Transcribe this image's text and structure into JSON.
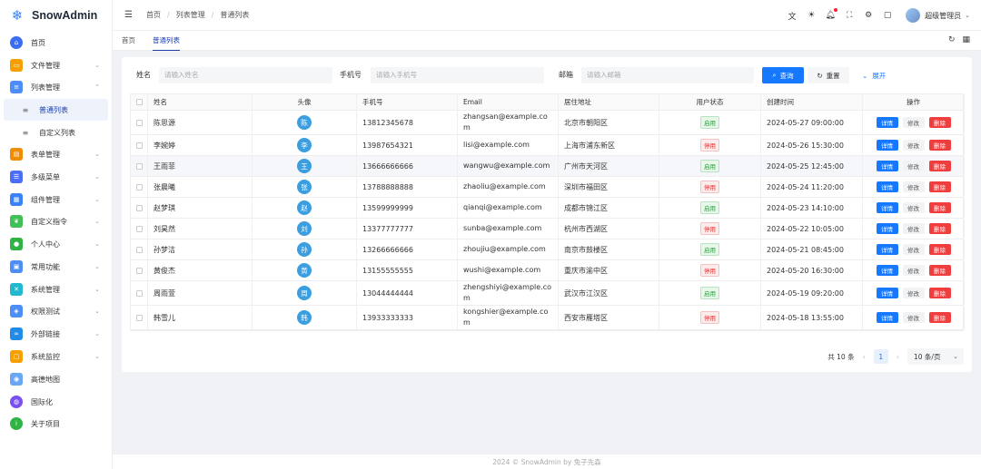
{
  "app": {
    "name": "SnowAdmin",
    "logo_icon": "snowflake-icon"
  },
  "sidebar": {
    "items": [
      {
        "label": "首页",
        "icon": "home-icon",
        "color": "#3b6df0",
        "expandable": false
      },
      {
        "label": "文件管理",
        "icon": "folder-icon",
        "color": "#f59f00",
        "expandable": true
      },
      {
        "label": "列表管理",
        "icon": "list-icon",
        "color": "#4c8df6",
        "expandable": true,
        "expanded": true
      },
      {
        "label": "普通列表",
        "sub": true,
        "active": true
      },
      {
        "label": "自定义列表",
        "sub": true
      },
      {
        "label": "表单管理",
        "icon": "form-icon",
        "color": "#f08c00",
        "expandable": true
      },
      {
        "label": "多级菜单",
        "icon": "menu-icon",
        "color": "#4c6ef5",
        "expandable": true
      },
      {
        "label": "组件管理",
        "icon": "grid-icon",
        "color": "#3b82f6",
        "expandable": true
      },
      {
        "label": "自定义指令",
        "icon": "leaf-icon",
        "color": "#40c057",
        "expandable": true
      },
      {
        "label": "个人中心",
        "icon": "user-icon",
        "color": "#2fb344",
        "expandable": true
      },
      {
        "label": "常用功能",
        "icon": "function-icon",
        "color": "#4c8df6",
        "expandable": true
      },
      {
        "label": "系统管理",
        "icon": "settings-icon",
        "color": "#22b8cf",
        "expandable": true
      },
      {
        "label": "权限测试",
        "icon": "shield-icon",
        "color": "#4c8df6",
        "expandable": true
      },
      {
        "label": "外部链接",
        "icon": "link-icon",
        "color": "#228be6",
        "expandable": true
      },
      {
        "label": "系统监控",
        "icon": "monitor-icon",
        "color": "#f59f00",
        "expandable": true
      },
      {
        "label": "高德地图",
        "icon": "map-icon",
        "color": "#69a7f5",
        "expandable": false
      },
      {
        "label": "国际化",
        "icon": "globe-icon",
        "color": "#7950f2",
        "expandable": false
      },
      {
        "label": "关于项目",
        "icon": "info-icon",
        "color": "#2fb344",
        "expandable": false
      }
    ]
  },
  "header": {
    "breadcrumb": [
      "首页",
      "列表管理",
      "普通列表"
    ],
    "user_name": "超级管理员",
    "icons": [
      "translate-icon",
      "sun-icon",
      "bell-icon",
      "fullscreen-icon",
      "gear-icon",
      "shirt-icon"
    ]
  },
  "tabs": [
    {
      "label": "首页",
      "active": false
    },
    {
      "label": "普通列表",
      "active": true
    }
  ],
  "search": {
    "name_label": "姓名",
    "name_placeholder": "请输入姓名",
    "phone_label": "手机号",
    "phone_placeholder": "请输入手机号",
    "email_label": "邮箱",
    "email_placeholder": "请输入邮箱",
    "query_label": "查询",
    "reset_label": "重置",
    "expand_label": "展开"
  },
  "table": {
    "columns": [
      "姓名",
      "头像",
      "手机号",
      "Email",
      "居住地址",
      "用户状态",
      "创建时间",
      "操作"
    ],
    "op_labels": {
      "detail": "详情",
      "edit": "修改",
      "delete": "删除"
    },
    "rows": [
      {
        "name": "陈思源",
        "avatar": "陈",
        "phone": "13812345678",
        "email": "zhangsan@example.com",
        "address": "北京市朝阳区",
        "status": "启用",
        "enabled": true,
        "created": "2024-05-27 09:00:00"
      },
      {
        "name": "李婉婷",
        "avatar": "李",
        "phone": "13987654321",
        "email": "lisi@example.com",
        "address": "上海市浦东新区",
        "status": "停用",
        "enabled": false,
        "created": "2024-05-26 15:30:00"
      },
      {
        "name": "王雨菲",
        "avatar": "王",
        "phone": "13666666666",
        "email": "wangwu@example.com",
        "address": "广州市天河区",
        "status": "启用",
        "enabled": true,
        "created": "2024-05-25 12:45:00"
      },
      {
        "name": "张晨曦",
        "avatar": "张",
        "phone": "13788888888",
        "email": "zhaoliu@example.com",
        "address": "深圳市福田区",
        "status": "停用",
        "enabled": false,
        "created": "2024-05-24 11:20:00"
      },
      {
        "name": "赵梦琪",
        "avatar": "赵",
        "phone": "13599999999",
        "email": "qianqi@example.com",
        "address": "成都市锦江区",
        "status": "启用",
        "enabled": true,
        "created": "2024-05-23 14:10:00"
      },
      {
        "name": "刘昊然",
        "avatar": "刘",
        "phone": "13377777777",
        "email": "sunba@example.com",
        "address": "杭州市西湖区",
        "status": "停用",
        "enabled": false,
        "created": "2024-05-22 10:05:00"
      },
      {
        "name": "孙梦洁",
        "avatar": "孙",
        "phone": "13266666666",
        "email": "zhoujiu@example.com",
        "address": "南京市鼓楼区",
        "status": "启用",
        "enabled": true,
        "created": "2024-05-21 08:45:00"
      },
      {
        "name": "黄俊杰",
        "avatar": "黄",
        "phone": "13155555555",
        "email": "wushi@example.com",
        "address": "重庆市渝中区",
        "status": "停用",
        "enabled": false,
        "created": "2024-05-20 16:30:00"
      },
      {
        "name": "周雨萱",
        "avatar": "周",
        "phone": "13044444444",
        "email": "zhengshiyi@example.com",
        "address": "武汉市江汉区",
        "status": "启用",
        "enabled": true,
        "created": "2024-05-19 09:20:00"
      },
      {
        "name": "韩雪儿",
        "avatar": "韩",
        "phone": "13933333333",
        "email": "kongshier@example.com",
        "address": "西安市雁塔区",
        "status": "停用",
        "enabled": false,
        "created": "2024-05-18 13:55:00"
      }
    ]
  },
  "pagination": {
    "total_text": "共 10 条",
    "current_page": "1",
    "page_size": "10 条/页"
  },
  "footer": {
    "text": "2024 © SnowAdmin by 兔子先森"
  }
}
